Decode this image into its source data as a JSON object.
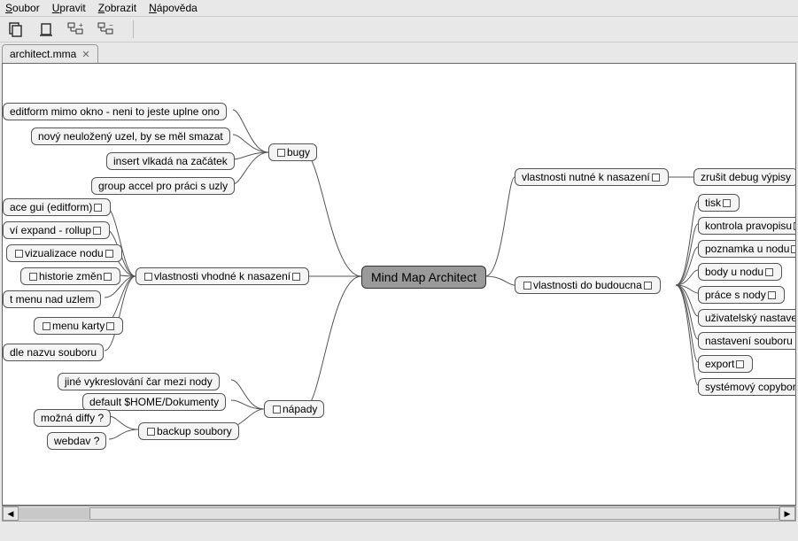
{
  "menu": {
    "file": "oubor",
    "edit": "pravit",
    "view": "obrazit",
    "help": "ápověda"
  },
  "tab": {
    "name": "architect.mma",
    "close": "✕"
  },
  "root": "Mind Map Architect",
  "left": {
    "bugy": "bugy",
    "bugy_items": [
      "editform mimo okno - neni to jeste uplne ono",
      "nový neuložený uzel, by se měl smazat",
      "insert vlkadá na začátek",
      "group accel pro práci s uzly"
    ],
    "vhodne": "vlastnosti vhodné k nasazení",
    "vhodne_items": [
      "ace gui (editform)",
      "ví expand - rollup",
      "vizualizace nodu",
      "historie změn",
      "t menu nad uzlem",
      "menu karty",
      "dle nazvu souboru"
    ],
    "napady": "nápady",
    "napady_items": [
      "jiné vykreslování čar mezi nody",
      "default $HOME/Dokumenty"
    ],
    "backup": "backup soubory",
    "backup_items": [
      "možná diffy ?",
      "webdav ?"
    ]
  },
  "right": {
    "nutne": "vlastnosti nutné k nasazení",
    "nutne_items": [
      "zrušit debug výpisy"
    ],
    "budoucna": "vlastnosti do budoucna",
    "budoucna_items": [
      "tisk",
      "kontrola pravopisu",
      "poznamka u nodu",
      "body u nodu",
      "práce s nody",
      "uživatelský nastave",
      "nastavení souboru",
      "export",
      "systémový copybor"
    ]
  }
}
